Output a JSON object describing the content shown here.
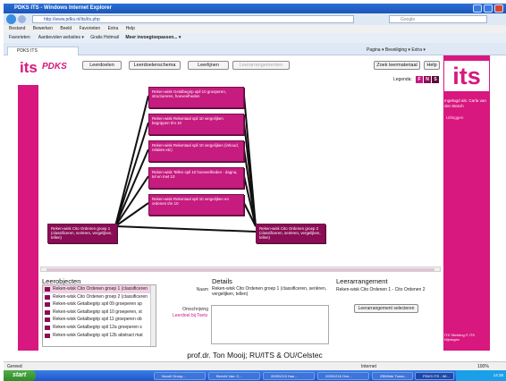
{
  "browser": {
    "title": "PDKS ITS - Windows Internet Explorer",
    "address": "http://www.pdks.nl/its/its.php",
    "search_placeholder": "Google",
    "menu": [
      "Bestand",
      "Bewerken",
      "Beeld",
      "Favorieten",
      "Extra",
      "Help"
    ],
    "favorites_label": "Favorieten",
    "favorites_links": [
      "Aanbevolen websites ▾",
      "Gratis Hotmail",
      "Meer invoegtoepassen... ▾"
    ],
    "tab_label": "PDKS ITS",
    "tools": "Pagina ▾   Beveiliging ▾   Extra ▾"
  },
  "app": {
    "logo_small": "its",
    "title": "PDKS",
    "logo_big": "its",
    "nav": [
      "Leerdoelen",
      "Leerdoelenschema",
      "Leerlijnen",
      "Leerarrangementen"
    ],
    "search_button": "Zoek leermateriaal",
    "help_button": "Help",
    "legend_label": "Legenda:",
    "legend_items": [
      "F",
      "N",
      "S"
    ],
    "login_info": "Ingelogd als: Carla van den Bosch",
    "logout": "Uitloggen",
    "footer_note": "ITS Stichting © ITS Nijmegen"
  },
  "diagram": {
    "source": "Reken-wisk Cito Ordenen groep 1 (classificeren, seriëren, vergelijken, tellen)",
    "target": "Reken-wisk Cito Ordenen groep 2 (classificeren, seriëren, vergelijken, tellen)",
    "middle": [
      "Reken-wisk Getalbegrip spil 10 groeperen, structureren, hoeveelheden",
      "Reken-wisk Rekentaal spil 10 vergelijken begrippen t/m 10",
      "Reken-wisk Rekentaal spil 10 vergelijken (inhoud, relaties etc)",
      "Reken-wisk Tellen spil 10 hoeveelheden - dagna, tel en met 10",
      "Reken-wisk Rekentaal spil 10 vergelijken en ordenen t/m 10"
    ]
  },
  "panels": {
    "objectives_title": "Leerobjecten",
    "objectives": [
      "Reken-wisk Cito Ordenen groep 1 (classificeren",
      "Reken-wisk Cito Ordenen groep 2 (classificeren",
      "Reken-wisk Getalbegrip spil 09 groeperen sp",
      "Reken-wisk Getalbegrip spil 10 groeperen, st",
      "Reken-wisk Getalbegrip spil 11 groeperen ob",
      "Reken-wisk Getalbegrip spil 12a groeperen s",
      "Reken-wisk Getalbegrip spil 12b abstract mat"
    ],
    "details_title": "Details",
    "name_label": "Naam",
    "name_value": "Reken-wisk Cito Ordenen groep 1 (classificeren, seriëren, vergelijken, tellen)",
    "description_label": "Omschrijving",
    "description_link": "Leerdoel bij Toets",
    "arrangement_title": "Leerarrangement",
    "arrangement_value": "Reken-wisk Cito Ordenen 1 - Cito Ordenen 2",
    "arrangement_button": "Leerarrangement selecteren"
  },
  "caption": "prof.dr. Ton Mooij; RU/ITS & OU/Celstec",
  "status": {
    "left": "Gereed",
    "zone": "Internet",
    "zoom": "100%"
  },
  "taskbar": {
    "start": "start",
    "tasks": [
      "Novell Group...",
      "Bericht Van: C...",
      "20091215 Han...",
      "20091216 Ove...",
      "ZBWhite Tussn...",
      "PDKS ITS - Wi..."
    ],
    "clock": "14:38"
  },
  "colors": {
    "brand": "#d8177f",
    "node": "#c61b7f",
    "node_dark": "#8a0d55",
    "legend": [
      "#c61b7f",
      "#8a0d55",
      "#5a0a39"
    ]
  }
}
